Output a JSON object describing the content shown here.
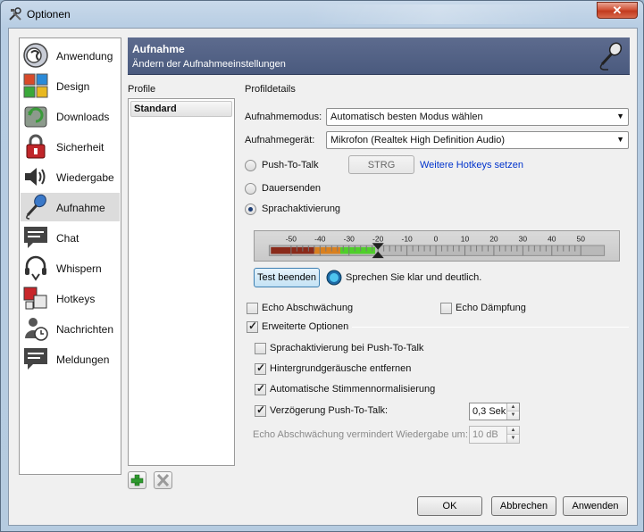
{
  "window": {
    "title": "Optionen",
    "close_label": "✕"
  },
  "sidebar": {
    "items": [
      {
        "label": "Anwendung",
        "icon": "application-icon"
      },
      {
        "label": "Design",
        "icon": "design-icon"
      },
      {
        "label": "Downloads",
        "icon": "downloads-icon"
      },
      {
        "label": "Sicherheit",
        "icon": "security-lock-icon"
      },
      {
        "label": "Wiedergabe",
        "icon": "speaker-icon"
      },
      {
        "label": "Aufnahme",
        "icon": "microphone-icon",
        "active": true
      },
      {
        "label": "Chat",
        "icon": "chat-icon"
      },
      {
        "label": "Whispern",
        "icon": "headset-icon"
      },
      {
        "label": "Hotkeys",
        "icon": "hotkeys-icon"
      },
      {
        "label": "Nachrichten",
        "icon": "messages-icon"
      },
      {
        "label": "Meldungen",
        "icon": "notifications-icon"
      }
    ]
  },
  "header": {
    "title": "Aufnahme",
    "subtitle": "Ändern der Aufnahmeeinstellungen",
    "icon": "microphone-icon"
  },
  "profiles": {
    "heading": "Profile",
    "items": [
      "Standard"
    ],
    "add_icon": "plus-icon",
    "remove_icon": "delete-x-icon"
  },
  "details": {
    "heading": "Profildetails",
    "mode_label": "Aufnahmemodus:",
    "mode_value": "Automatisch besten Modus wählen",
    "device_label": "Aufnahmegerät:",
    "device_value": "Mikrofon (Realtek High Definition Audio)",
    "ptt_label": "Push-To-Talk",
    "ptt_key": "STRG",
    "more_hotkeys": "Weitere Hotkeys setzen",
    "continuous_label": "Dauersenden",
    "voice_label": "Sprachaktivierung",
    "selected_mode": "Sprachaktivierung",
    "meter": {
      "ticks": [
        "-50",
        "-40",
        "-30",
        "-20",
        "-10",
        "0",
        "10",
        "20",
        "30",
        "40",
        "50"
      ],
      "level_db": -29,
      "threshold_db": -20
    },
    "test_button": "Test beenden",
    "test_status": "Sprechen Sie klar und deutlich.",
    "echo_reduction": "Echo Abschwächung",
    "echo_reduction_checked": false,
    "echo_damping": "Echo Dämpfung",
    "echo_damping_checked": false,
    "advanced_label": "Erweiterte Optionen",
    "advanced_checked": true,
    "adv_voice_ptt": "Sprachaktivierung bei Push-To-Talk",
    "adv_voice_ptt_checked": false,
    "adv_noise": "Hintergrundgeräusche entfernen",
    "adv_noise_checked": true,
    "adv_normalize": "Automatische Stimmennormalisierung",
    "adv_normalize_checked": true,
    "adv_delay": "Verzögerung Push-To-Talk:",
    "adv_delay_checked": true,
    "adv_delay_value": "0,3 Sek",
    "echo_reduce_playback": "Echo Abschwächung vermindert Wiedergabe um:",
    "echo_reduce_value": "10 dB"
  },
  "footer": {
    "ok": "OK",
    "cancel": "Abbrechen",
    "apply": "Anwenden"
  }
}
